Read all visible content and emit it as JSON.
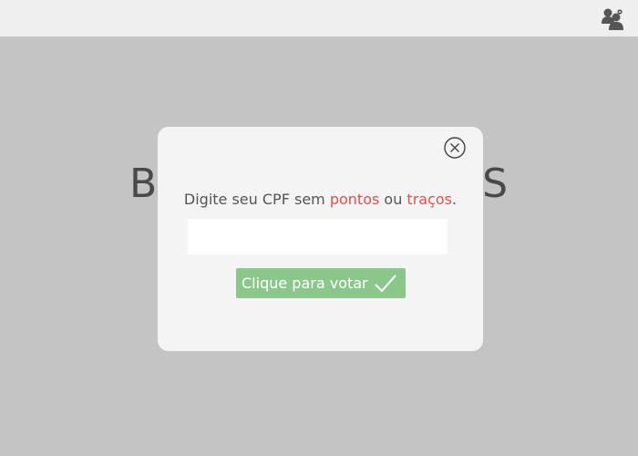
{
  "background": {
    "title_visible_left": "B",
    "title_visible_right": "S"
  },
  "modal": {
    "prompt_prefix": "Digite seu CPF sem ",
    "prompt_highlight_1": "pontos",
    "prompt_middle": " ou ",
    "prompt_highlight_2": "traços",
    "prompt_suffix": ".",
    "cpf_value": "",
    "vote_button_label": "Clique para votar"
  },
  "icons": {
    "user": "users-icon",
    "close": "close-circle-icon",
    "check": "check-icon"
  },
  "colors": {
    "topbar": "#efefef",
    "backdrop": "#c4c4c4",
    "modal": "#f4f4f4",
    "highlight": "#d9534f",
    "button": "#8bc78b"
  }
}
